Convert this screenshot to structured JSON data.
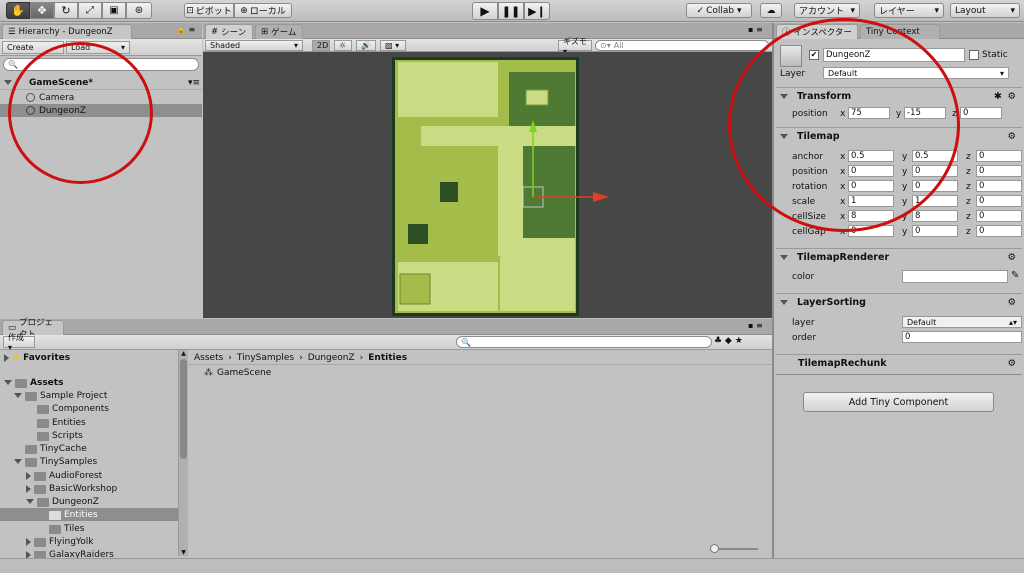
{
  "toolbar": {
    "pivot": "ピボット",
    "local": "ローカル",
    "collab": "Collab ▾",
    "account": "アカウント",
    "layers": "レイヤー",
    "layout": "Layout"
  },
  "hierarchy": {
    "tab": "Hierarchy - DungeonZ",
    "create": "Create",
    "load": "Load",
    "scene": "GameScene*",
    "items": [
      "Camera",
      "DungeonZ"
    ]
  },
  "scene": {
    "tab_scene": "シーン",
    "tab_game": "ゲーム",
    "shaded": "Shaded",
    "mode_2d": "2D",
    "gizmos": "ギズモ ▾",
    "search_placeholder": "All"
  },
  "project": {
    "tab": "プロジェクト",
    "create": "作成 ▾",
    "favorites": "Favorites",
    "assets": "Assets",
    "tree": [
      "Sample Project",
      "Components",
      "Entities",
      "Scripts",
      "TinyCache",
      "TinySamples",
      "AudioForest",
      "BasicWorkshop",
      "DungeonZ",
      "Entities",
      "Tiles",
      "FlyingYolk",
      "GalaxyRaiders"
    ],
    "breadcrumb": [
      "Assets",
      "TinySamples",
      "DungeonZ",
      "Entities"
    ],
    "file": "GameScene"
  },
  "inspector": {
    "tab": "インスペクター",
    "tab_tiny": "Tiny Context",
    "name": "DungeonZ",
    "static_label": "Static",
    "layer_label": "Layer",
    "layer_value": "Default",
    "transform": {
      "title": "Transform",
      "position_label": "position",
      "x": "75",
      "y": "-15",
      "z": "0"
    },
    "tilemap": {
      "title": "Tilemap",
      "rows": [
        {
          "label": "anchor",
          "x": "0.5",
          "y": "0.5",
          "z": "0"
        },
        {
          "label": "position",
          "x": "0",
          "y": "0",
          "z": "0"
        },
        {
          "label": "rotation",
          "x": "0",
          "y": "0",
          "z": "0"
        },
        {
          "label": "scale",
          "x": "1",
          "y": "1",
          "z": "0"
        },
        {
          "label": "cellSize",
          "x": "8",
          "y": "8",
          "z": "0"
        },
        {
          "label": "cellGap",
          "x": "0",
          "y": "0",
          "z": "0"
        }
      ]
    },
    "renderer": {
      "title": "TilemapRenderer",
      "color_label": "color"
    },
    "sorting": {
      "title": "LayerSorting",
      "layer_label": "layer",
      "layer_value": "Default",
      "order_label": "order",
      "order_value": "0"
    },
    "rechunk": {
      "title": "TilemapRechunk"
    },
    "add_button": "Add Tiny Component"
  },
  "axis_labels": {
    "x": "x",
    "y": "y",
    "z": "z"
  },
  "colors": {
    "annotation_red": "#cc1010",
    "tile_light": "#c9dc84",
    "tile_mid": "#a4bc4a",
    "tile_dark": "#4e7a34",
    "scene_bg": "#474747"
  }
}
